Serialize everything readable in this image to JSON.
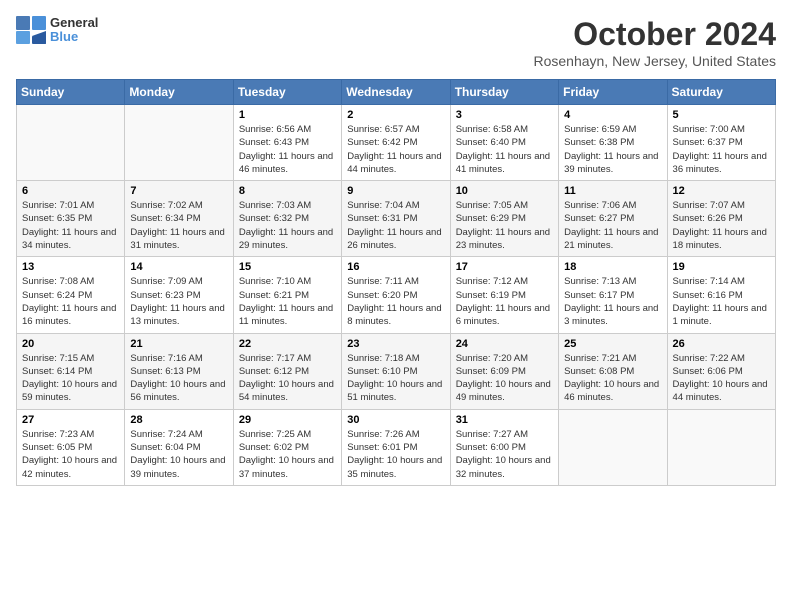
{
  "header": {
    "logo_general": "General",
    "logo_blue": "Blue",
    "month": "October 2024",
    "location": "Rosenhayn, New Jersey, United States"
  },
  "days_of_week": [
    "Sunday",
    "Monday",
    "Tuesday",
    "Wednesday",
    "Thursday",
    "Friday",
    "Saturday"
  ],
  "weeks": [
    {
      "days": [
        {
          "num": "",
          "sunrise": "",
          "sunset": "",
          "daylight": ""
        },
        {
          "num": "",
          "sunrise": "",
          "sunset": "",
          "daylight": ""
        },
        {
          "num": "1",
          "sunrise": "Sunrise: 6:56 AM",
          "sunset": "Sunset: 6:43 PM",
          "daylight": "Daylight: 11 hours and 46 minutes."
        },
        {
          "num": "2",
          "sunrise": "Sunrise: 6:57 AM",
          "sunset": "Sunset: 6:42 PM",
          "daylight": "Daylight: 11 hours and 44 minutes."
        },
        {
          "num": "3",
          "sunrise": "Sunrise: 6:58 AM",
          "sunset": "Sunset: 6:40 PM",
          "daylight": "Daylight: 11 hours and 41 minutes."
        },
        {
          "num": "4",
          "sunrise": "Sunrise: 6:59 AM",
          "sunset": "Sunset: 6:38 PM",
          "daylight": "Daylight: 11 hours and 39 minutes."
        },
        {
          "num": "5",
          "sunrise": "Sunrise: 7:00 AM",
          "sunset": "Sunset: 6:37 PM",
          "daylight": "Daylight: 11 hours and 36 minutes."
        }
      ]
    },
    {
      "days": [
        {
          "num": "6",
          "sunrise": "Sunrise: 7:01 AM",
          "sunset": "Sunset: 6:35 PM",
          "daylight": "Daylight: 11 hours and 34 minutes."
        },
        {
          "num": "7",
          "sunrise": "Sunrise: 7:02 AM",
          "sunset": "Sunset: 6:34 PM",
          "daylight": "Daylight: 11 hours and 31 minutes."
        },
        {
          "num": "8",
          "sunrise": "Sunrise: 7:03 AM",
          "sunset": "Sunset: 6:32 PM",
          "daylight": "Daylight: 11 hours and 29 minutes."
        },
        {
          "num": "9",
          "sunrise": "Sunrise: 7:04 AM",
          "sunset": "Sunset: 6:31 PM",
          "daylight": "Daylight: 11 hours and 26 minutes."
        },
        {
          "num": "10",
          "sunrise": "Sunrise: 7:05 AM",
          "sunset": "Sunset: 6:29 PM",
          "daylight": "Daylight: 11 hours and 23 minutes."
        },
        {
          "num": "11",
          "sunrise": "Sunrise: 7:06 AM",
          "sunset": "Sunset: 6:27 PM",
          "daylight": "Daylight: 11 hours and 21 minutes."
        },
        {
          "num": "12",
          "sunrise": "Sunrise: 7:07 AM",
          "sunset": "Sunset: 6:26 PM",
          "daylight": "Daylight: 11 hours and 18 minutes."
        }
      ]
    },
    {
      "days": [
        {
          "num": "13",
          "sunrise": "Sunrise: 7:08 AM",
          "sunset": "Sunset: 6:24 PM",
          "daylight": "Daylight: 11 hours and 16 minutes."
        },
        {
          "num": "14",
          "sunrise": "Sunrise: 7:09 AM",
          "sunset": "Sunset: 6:23 PM",
          "daylight": "Daylight: 11 hours and 13 minutes."
        },
        {
          "num": "15",
          "sunrise": "Sunrise: 7:10 AM",
          "sunset": "Sunset: 6:21 PM",
          "daylight": "Daylight: 11 hours and 11 minutes."
        },
        {
          "num": "16",
          "sunrise": "Sunrise: 7:11 AM",
          "sunset": "Sunset: 6:20 PM",
          "daylight": "Daylight: 11 hours and 8 minutes."
        },
        {
          "num": "17",
          "sunrise": "Sunrise: 7:12 AM",
          "sunset": "Sunset: 6:19 PM",
          "daylight": "Daylight: 11 hours and 6 minutes."
        },
        {
          "num": "18",
          "sunrise": "Sunrise: 7:13 AM",
          "sunset": "Sunset: 6:17 PM",
          "daylight": "Daylight: 11 hours and 3 minutes."
        },
        {
          "num": "19",
          "sunrise": "Sunrise: 7:14 AM",
          "sunset": "Sunset: 6:16 PM",
          "daylight": "Daylight: 11 hours and 1 minute."
        }
      ]
    },
    {
      "days": [
        {
          "num": "20",
          "sunrise": "Sunrise: 7:15 AM",
          "sunset": "Sunset: 6:14 PM",
          "daylight": "Daylight: 10 hours and 59 minutes."
        },
        {
          "num": "21",
          "sunrise": "Sunrise: 7:16 AM",
          "sunset": "Sunset: 6:13 PM",
          "daylight": "Daylight: 10 hours and 56 minutes."
        },
        {
          "num": "22",
          "sunrise": "Sunrise: 7:17 AM",
          "sunset": "Sunset: 6:12 PM",
          "daylight": "Daylight: 10 hours and 54 minutes."
        },
        {
          "num": "23",
          "sunrise": "Sunrise: 7:18 AM",
          "sunset": "Sunset: 6:10 PM",
          "daylight": "Daylight: 10 hours and 51 minutes."
        },
        {
          "num": "24",
          "sunrise": "Sunrise: 7:20 AM",
          "sunset": "Sunset: 6:09 PM",
          "daylight": "Daylight: 10 hours and 49 minutes."
        },
        {
          "num": "25",
          "sunrise": "Sunrise: 7:21 AM",
          "sunset": "Sunset: 6:08 PM",
          "daylight": "Daylight: 10 hours and 46 minutes."
        },
        {
          "num": "26",
          "sunrise": "Sunrise: 7:22 AM",
          "sunset": "Sunset: 6:06 PM",
          "daylight": "Daylight: 10 hours and 44 minutes."
        }
      ]
    },
    {
      "days": [
        {
          "num": "27",
          "sunrise": "Sunrise: 7:23 AM",
          "sunset": "Sunset: 6:05 PM",
          "daylight": "Daylight: 10 hours and 42 minutes."
        },
        {
          "num": "28",
          "sunrise": "Sunrise: 7:24 AM",
          "sunset": "Sunset: 6:04 PM",
          "daylight": "Daylight: 10 hours and 39 minutes."
        },
        {
          "num": "29",
          "sunrise": "Sunrise: 7:25 AM",
          "sunset": "Sunset: 6:02 PM",
          "daylight": "Daylight: 10 hours and 37 minutes."
        },
        {
          "num": "30",
          "sunrise": "Sunrise: 7:26 AM",
          "sunset": "Sunset: 6:01 PM",
          "daylight": "Daylight: 10 hours and 35 minutes."
        },
        {
          "num": "31",
          "sunrise": "Sunrise: 7:27 AM",
          "sunset": "Sunset: 6:00 PM",
          "daylight": "Daylight: 10 hours and 32 minutes."
        },
        {
          "num": "",
          "sunrise": "",
          "sunset": "",
          "daylight": ""
        },
        {
          "num": "",
          "sunrise": "",
          "sunset": "",
          "daylight": ""
        }
      ]
    }
  ]
}
